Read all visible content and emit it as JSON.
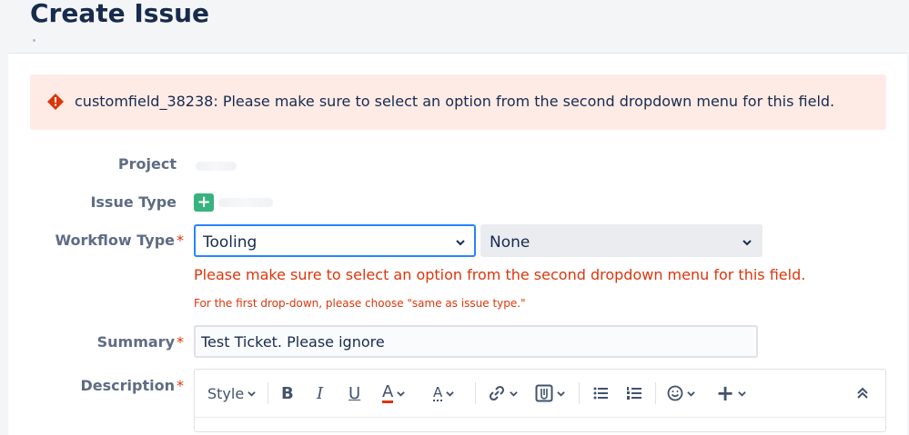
{
  "page": {
    "title": "Create Issue"
  },
  "error_banner": {
    "message": "customfield_38238: Please make sure to select an option from the second dropdown menu for this field."
  },
  "form": {
    "project": {
      "label": "Project"
    },
    "issue_type": {
      "label": "Issue Type",
      "icon": "+"
    },
    "workflow_type": {
      "label": "Workflow Type",
      "required_mark": "*",
      "first_select_value": "Tooling",
      "second_select_value": "None",
      "error": "Please make sure to select an option from the second dropdown menu for this field.",
      "hint": "For the first drop-down, please choose \"same as issue type.\""
    },
    "summary": {
      "label": "Summary",
      "required_mark": "*",
      "value": "Test Ticket. Please ignore"
    },
    "description": {
      "label": "Description",
      "required_mark": "*"
    }
  },
  "toolbar": {
    "style_label": "Style",
    "bold": "B",
    "italic": "I",
    "underline": "U",
    "text_color": "A",
    "more_formatting": "A",
    "bullet_list_icon": "bullet-list-icon",
    "numbered_list_icon": "numbered-list-icon",
    "emoji_icon": "emoji-icon",
    "insert": "+"
  },
  "colors": {
    "error": "#de350b",
    "focus": "#2684ff",
    "banner_bg": "#ffebe6",
    "issue_icon": "#36b37e"
  }
}
